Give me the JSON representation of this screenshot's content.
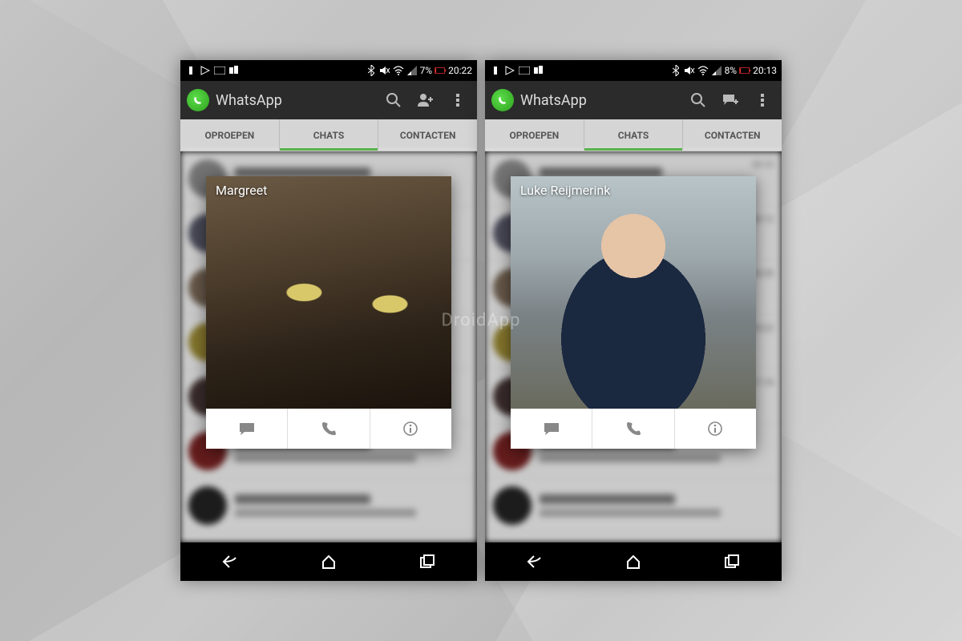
{
  "watermark": "DroidApp",
  "phones": [
    {
      "status": {
        "battery_pct": "7%",
        "time": "20:22"
      },
      "app_title": "WhatsApp",
      "tabs": {
        "calls": "OPROEPEN",
        "chats": "CHATS",
        "contacts": "CONTACTEN",
        "active": "chats"
      },
      "popup": {
        "name": "Margreet",
        "photo": "cat"
      },
      "second_action_icon": "add-contact",
      "chat_times": [
        "",
        "",
        "",
        "",
        "",
        "",
        ""
      ]
    },
    {
      "status": {
        "battery_pct": "8%",
        "time": "20:13"
      },
      "app_title": "WhatsApp",
      "tabs": {
        "calls": "OPROEPEN",
        "chats": "CHATS",
        "contacts": "CONTACTEN",
        "active": "chats"
      },
      "popup": {
        "name": "Luke Reijmerink",
        "photo": "person"
      },
      "second_action_icon": "new-chat",
      "chat_times": [
        "20:12",
        "20:12",
        "18:39",
        "18:22",
        "17:18",
        "",
        ""
      ]
    }
  ]
}
